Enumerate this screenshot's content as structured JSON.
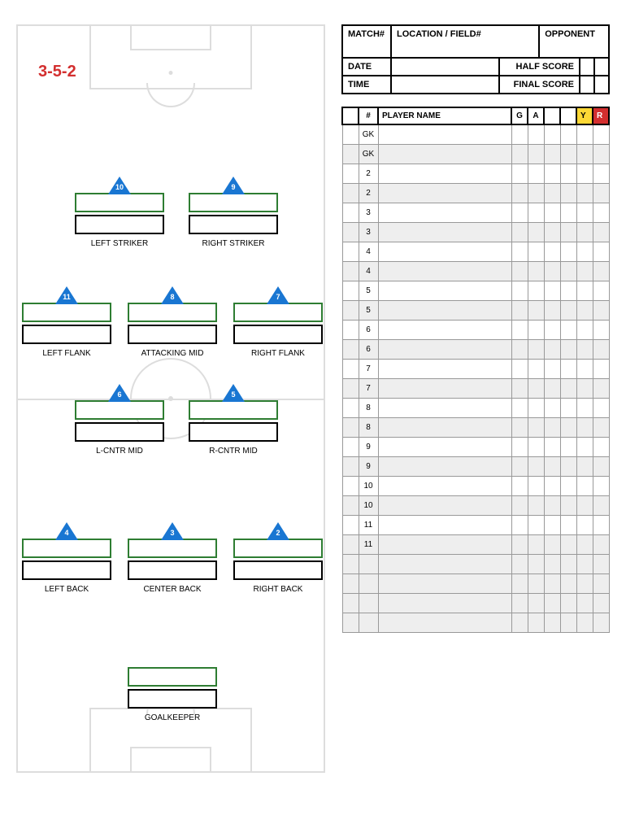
{
  "formation": "3-5-2",
  "header": {
    "match": "MATCH#",
    "location": "LOCATION / FIELD#",
    "opponent": "OPPONENT",
    "date": "DATE",
    "half_score": "HALF SCORE",
    "time": "TIME",
    "final_score": "FINAL SCORE"
  },
  "roster_headers": {
    "num": "#",
    "player_name": "PLAYER NAME",
    "g": "G",
    "a": "A",
    "y": "Y",
    "r": "R"
  },
  "positions": {
    "left_striker": {
      "num": "10",
      "label": "LEFT STRIKER"
    },
    "right_striker": {
      "num": "9",
      "label": "RIGHT STRIKER"
    },
    "left_flank": {
      "num": "11",
      "label": "LEFT FLANK"
    },
    "attacking_mid": {
      "num": "8",
      "label": "ATTACKING MID"
    },
    "right_flank": {
      "num": "7",
      "label": "RIGHT FLANK"
    },
    "l_cntr_mid": {
      "num": "6",
      "label": "L-CNTR MID"
    },
    "r_cntr_mid": {
      "num": "5",
      "label": "R-CNTR MID"
    },
    "left_back": {
      "num": "4",
      "label": "LEFT BACK"
    },
    "center_back": {
      "num": "3",
      "label": "CENTER BACK"
    },
    "right_back": {
      "num": "2",
      "label": "RIGHT BACK"
    },
    "goalkeeper": {
      "label": "GOALKEEPER"
    }
  },
  "roster_rows": [
    {
      "label": "GK",
      "shaded": false
    },
    {
      "label": "GK",
      "shaded": true
    },
    {
      "label": "2",
      "shaded": false
    },
    {
      "label": "2",
      "shaded": true
    },
    {
      "label": "3",
      "shaded": false
    },
    {
      "label": "3",
      "shaded": true
    },
    {
      "label": "4",
      "shaded": false
    },
    {
      "label": "4",
      "shaded": true
    },
    {
      "label": "5",
      "shaded": false
    },
    {
      "label": "5",
      "shaded": true
    },
    {
      "label": "6",
      "shaded": false
    },
    {
      "label": "6",
      "shaded": true
    },
    {
      "label": "7",
      "shaded": false
    },
    {
      "label": "7",
      "shaded": true
    },
    {
      "label": "8",
      "shaded": false
    },
    {
      "label": "8",
      "shaded": true
    },
    {
      "label": "9",
      "shaded": false
    },
    {
      "label": "9",
      "shaded": true
    },
    {
      "label": "10",
      "shaded": false
    },
    {
      "label": "10",
      "shaded": true
    },
    {
      "label": "11",
      "shaded": false
    },
    {
      "label": "11",
      "shaded": true
    },
    {
      "label": "",
      "shaded": true
    },
    {
      "label": "",
      "shaded": true
    },
    {
      "label": "",
      "shaded": true
    },
    {
      "label": "",
      "shaded": true
    }
  ]
}
